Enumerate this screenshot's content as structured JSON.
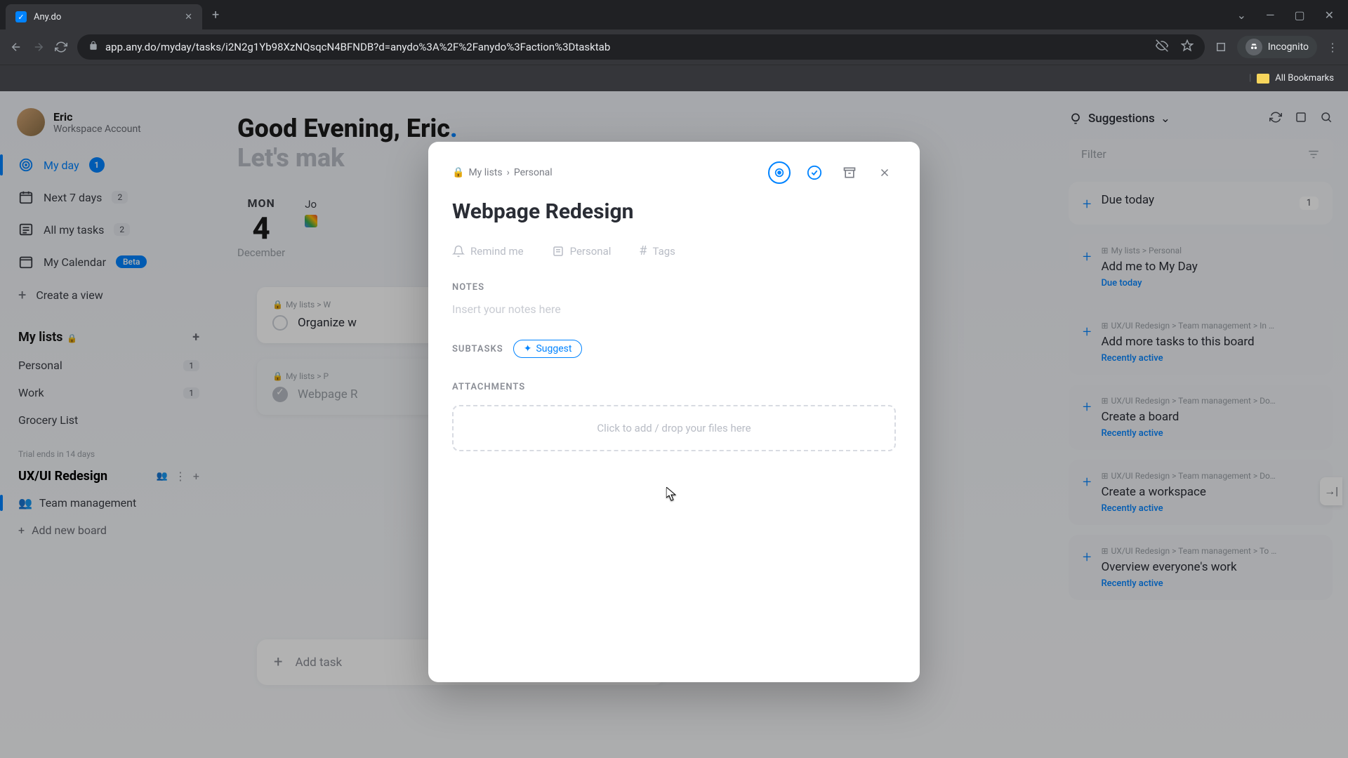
{
  "browser": {
    "tab_title": "Any.do",
    "url": "app.any.do/myday/tasks/i2N2g1Yb98XzNQsqcN4BFNDB?d=anydo%3A%2F%2Fanydo%3Faction%3Dtasktab",
    "incognito": "Incognito",
    "bookmarks": "All Bookmarks"
  },
  "profile": {
    "name": "Eric",
    "account": "Workspace Account"
  },
  "nav": {
    "myday": "My day",
    "myday_count": "1",
    "next7": "Next 7 days",
    "next7_count": "2",
    "all": "All my tasks",
    "all_count": "2",
    "calendar": "My Calendar",
    "beta": "Beta",
    "create_view": "Create a view"
  },
  "lists": {
    "header": "My lists",
    "personal": "Personal",
    "personal_count": "1",
    "work": "Work",
    "work_count": "1",
    "grocery": "Grocery List"
  },
  "project": {
    "trial": "Trial ends in 14 days",
    "name": "UX/UI Redesign",
    "team": "Team management",
    "addboard": "Add new board"
  },
  "main": {
    "greet1a": "Good Evening, Eric",
    "greet2": "Let's mak",
    "dow": "MON",
    "day": "4",
    "month": "December",
    "join": "Jo",
    "task1_bc": "My lists > W",
    "task1": "Organize w",
    "task2_bc": "My lists > P",
    "task2": "Webpage R",
    "add_task": "Add task"
  },
  "right": {
    "suggestions": "Suggestions",
    "filter": "Filter",
    "items": [
      {
        "bc": "My lists > Personal",
        "title": "Add me to My Day",
        "meta": "Due today"
      },
      {
        "bc": "UX/UI Redesign > Team management > In …",
        "title": "Add more tasks to this board",
        "meta": "Recently active"
      },
      {
        "bc": "UX/UI Redesign > Team management > Do…",
        "title": "Create a board",
        "meta": "Recently active"
      },
      {
        "bc": "UX/UI Redesign > Team management > Do…",
        "title": "Create a workspace",
        "meta": "Recently active"
      },
      {
        "bc": "UX/UI Redesign > Team management > To …",
        "title": "Overview everyone's work",
        "meta": "Recently active"
      }
    ],
    "due_today": "Due today",
    "due_count": "1"
  },
  "modal": {
    "bc1": "My lists",
    "bc2": "Personal",
    "title": "Webpage Redesign",
    "remind": "Remind me",
    "list": "Personal",
    "tags": "Tags",
    "notes_lbl": "NOTES",
    "notes_ph": "Insert your notes here",
    "subtasks_lbl": "SUBTASKS",
    "suggest": "Suggest",
    "attach_lbl": "ATTACHMENTS",
    "attach_ph": "Click to add / drop your files here"
  }
}
